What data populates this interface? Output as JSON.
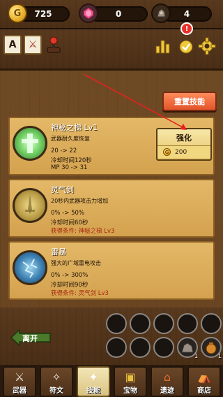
{
  "resources": {
    "gold": "725",
    "gem": "0",
    "stone": "4"
  },
  "alert_badge": "!",
  "reset_button": "重置技能",
  "skills": [
    {
      "name": "神秘之梯 Lv1",
      "desc": "武器耐久度恢复",
      "line1": "20 -> 22",
      "line2": "冷却时间120秒",
      "line3": "MP 30 -> 31"
    },
    {
      "name": "灵气剑",
      "desc": "20秒内武器攻击力增加",
      "line1": "0% -> 50%",
      "line2": "冷却时间60秒",
      "line3": "获得条件: 神秘之梯 Lv3"
    },
    {
      "name": "雷暴",
      "desc": "强大的广域雷电攻击",
      "line1": "0% -> 300%",
      "line2": "冷却时间90秒",
      "line3": "获得条件: 灵气剑 Lv3"
    }
  ],
  "upgrade": {
    "label": "强化",
    "cost": "200"
  },
  "leave_button": "离开",
  "slot_counts": [
    "1",
    "1"
  ],
  "nav": [
    {
      "label": "武器"
    },
    {
      "label": "符文"
    },
    {
      "label": "技能"
    },
    {
      "label": "宝物"
    },
    {
      "label": "遗迹"
    },
    {
      "label": "商店"
    }
  ]
}
